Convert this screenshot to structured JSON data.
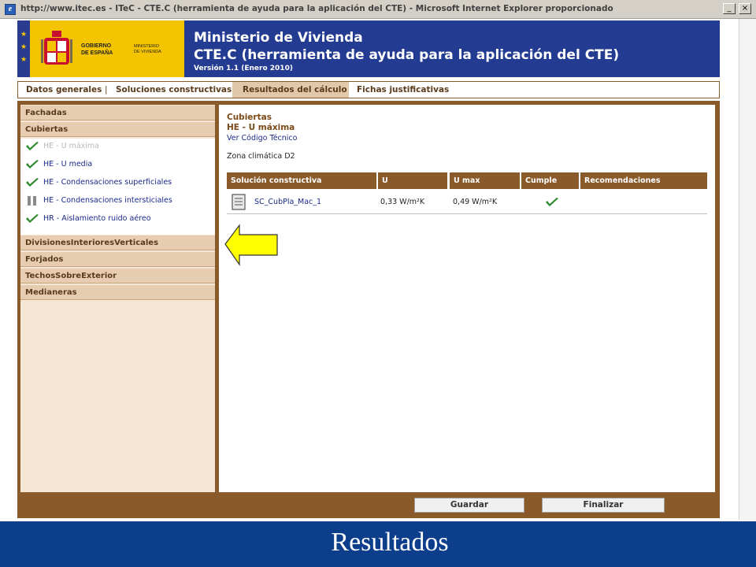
{
  "browser": {
    "title": "http://www.itec.es - ITeC - CTE.C (herramienta de ayuda para la aplicación del CTE) - Microsoft Internet Explorer proporcionado",
    "minimize_icon": "minimize-icon",
    "close_icon": "close-icon"
  },
  "header": {
    "gov_line1": "GOBIERNO",
    "gov_line2": "DE ESPAÑA",
    "ministry_line1": "MINISTERIO",
    "ministry_line2": "DE VIVIENDA",
    "ministry": "Ministerio de Vivienda",
    "app_title": "CTE.C (herramienta de ayuda para la aplicación del CTE)",
    "version": "Versión 1.1 (Enero 2010)",
    "colors": {
      "banner": "#233c92",
      "logo_bg": "#f5c400"
    }
  },
  "tabs": [
    {
      "label": "Datos generales",
      "active": false
    },
    {
      "label": "Soluciones constructivas",
      "active": false
    },
    {
      "label": "Resultados del cálculo",
      "active": true
    },
    {
      "label": "Fichas justificativas",
      "active": false
    }
  ],
  "tab_separator": "|",
  "sidebar": {
    "sections_top": [
      {
        "label": "Fachadas"
      },
      {
        "label": "Cubiertas"
      }
    ],
    "sub_items": [
      {
        "label": "HE - U máxima",
        "icon": "check-icon",
        "selected": true
      },
      {
        "label": "HE - U media",
        "icon": "check-icon",
        "selected": false
      },
      {
        "label": "HE - Condensaciones superficiales",
        "icon": "check-icon",
        "selected": false
      },
      {
        "label": "HE - Condensaciones intersticiales",
        "icon": "pause-icon",
        "selected": false
      },
      {
        "label": "HR - Aislamiento ruido aéreo",
        "icon": "check-icon",
        "selected": false
      }
    ],
    "sections_bottom": [
      {
        "label": "DivisionesInterioresVerticales"
      },
      {
        "label": "Forjados"
      },
      {
        "label": "TechosSobreExterior"
      },
      {
        "label": "Medianeras"
      }
    ]
  },
  "content": {
    "section": "Cubiertas",
    "subsection": "HE - U máxima",
    "link": "Ver Código Técnico",
    "zone": "Zona climática D2",
    "table": {
      "headers": [
        "Solución constructiva",
        "U",
        "U max",
        "Cumple",
        "Recomendaciones"
      ],
      "rows": [
        {
          "solution": "SC_CubPla_Mac_1",
          "u": "0,33 W/m²K",
          "umax": "0,49 W/m²K",
          "cumple": "check-icon",
          "recomendaciones": ""
        }
      ]
    }
  },
  "annotation": {
    "arrow": "left-arrow-icon",
    "color": "#ffff00"
  },
  "buttons": {
    "save": "Guardar",
    "finish": "Finalizar"
  },
  "caption": "Resultados"
}
